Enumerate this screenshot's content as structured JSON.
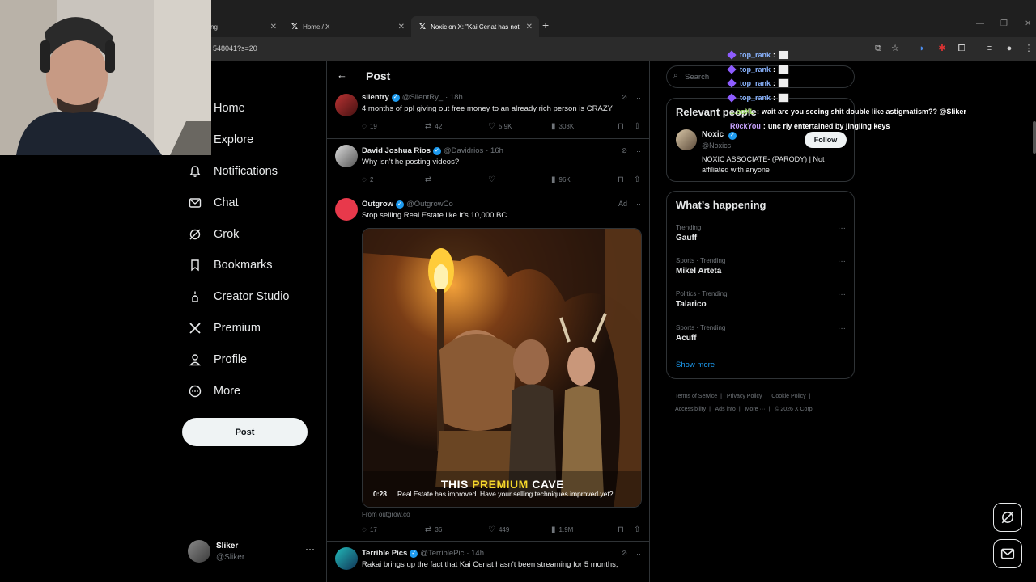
{
  "browser": {
    "tabs": [
      {
        "label": "ng",
        "active": false
      },
      {
        "label": "Home / X",
        "active": false
      },
      {
        "label": "Noxic on X: \"Kai Cenat has not",
        "active": true
      }
    ],
    "new_tab": "+",
    "url": "548041?s=20"
  },
  "nav": {
    "items": [
      {
        "label": "Home",
        "icon": "home-icon"
      },
      {
        "label": "Explore",
        "icon": "search-icon"
      },
      {
        "label": "Notifications",
        "icon": "bell-icon"
      },
      {
        "label": "Chat",
        "icon": "envelope-icon"
      },
      {
        "label": "Grok",
        "icon": "grok-icon"
      },
      {
        "label": "Bookmarks",
        "icon": "bookmark-icon"
      },
      {
        "label": "Creator Studio",
        "icon": "creator-icon"
      },
      {
        "label": "Premium",
        "icon": "x-logo-icon"
      },
      {
        "label": "Profile",
        "icon": "person-icon"
      },
      {
        "label": "More",
        "icon": "more-circle-icon"
      }
    ],
    "post_button": "Post",
    "account": {
      "name": "Sliker",
      "handle": "@Sliker",
      "more": "···"
    }
  },
  "main": {
    "title": "Post",
    "tweets": [
      {
        "name": "silentry",
        "handle": "@SilentRy_",
        "time": "· 18h",
        "text": "4 months of ppl giving out free money to an already rich person is CRAZY",
        "replies": "19",
        "reposts": "42",
        "likes": "5.9K",
        "views": "303K"
      },
      {
        "name": "David Joshua Rios",
        "handle": "@Davidrios",
        "time": "· 16h",
        "text": "Why isn't he posting videos?",
        "replies": "2",
        "reposts": "",
        "likes": "",
        "views": "96K"
      },
      {
        "name": "Outgrow",
        "handle": "@OutgrowCo",
        "time": "Ad",
        "text": "Stop selling Real Estate like it's 10,000 BC",
        "replies": "17",
        "reposts": "36",
        "likes": "449",
        "views": "1.9M",
        "media": {
          "caption_pre": "THIS ",
          "caption_highlight": "PREMIUM",
          "caption_post": " CAVE",
          "duration": "0:28",
          "subtitle": "Real Estate has improved. Have your selling techniques improved yet?"
        },
        "from": "From outgrow.co"
      },
      {
        "name": "Terrible Pics",
        "handle": "@TerriblePic",
        "time": "· 14h",
        "text": "Rakai brings up the fact that Kai Cenat hasn't been streaming for 5 months,"
      }
    ]
  },
  "sidebar": {
    "search_placeholder": "Search",
    "relevant": {
      "title": "Relevant people",
      "name": "Noxic",
      "handle": "@Noxics",
      "bio": "NOXIC ASSOCIATE- (PARODY) | Not affiliated with anyone",
      "follow": "Follow"
    },
    "happening": {
      "title": "What’s happening",
      "trends": [
        {
          "context": "Trending",
          "name": "Gauff"
        },
        {
          "context": "Sports · Trending",
          "name": "Mikel Arteta"
        },
        {
          "context": "Politics · Trending",
          "name": "Talarico"
        },
        {
          "context": "Sports · Trending",
          "name": "Acuff"
        }
      ],
      "show_more": "Show more"
    },
    "footer": [
      "Terms of Service",
      "|",
      "Privacy Policy",
      "|",
      "Cookie Policy",
      "|",
      "Accessibility",
      "|",
      "Ads info",
      "|",
      "More ···",
      "|",
      "© 2026 X Corp."
    ]
  },
  "chat_overlay": [
    {
      "user": "top_rank",
      "msg": ""
    },
    {
      "user": "top_rank",
      "msg": ""
    },
    {
      "user": "top_rank",
      "msg": ""
    },
    {
      "user": "top_rank",
      "msg": ""
    },
    {
      "user": "...boXL",
      "msg": "wait are you seeing shit double like astigmatism?? @Sliker"
    },
    {
      "user": "R0ckYou",
      "msg": "unc rly entertained by jingling keys"
    }
  ],
  "colors": {
    "accent": "#1d9bf0",
    "background": "#000000",
    "text": "#e7e9ea",
    "muted": "#71767b"
  }
}
